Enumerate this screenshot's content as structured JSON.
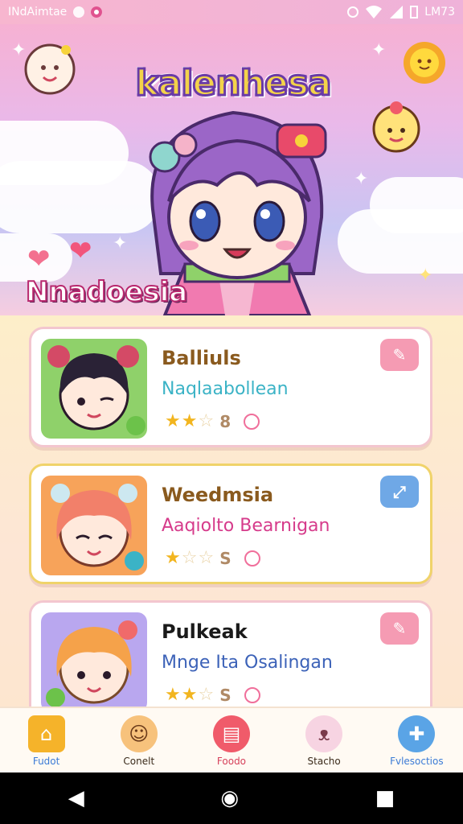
{
  "status_bar": {
    "left_text": "INdAimtae",
    "time": "LM73"
  },
  "hero": {
    "app_title": "kalenhesa",
    "subtitle": "Nnadoesia"
  },
  "cards": [
    {
      "name": "Balliuls",
      "tagline": "Naqlaabollean",
      "rating": "8",
      "stars_filled": 2,
      "stars_total": 3,
      "tag_color": "#3bb3c6",
      "action_icon": "pencil-icon",
      "action_color": "#f59bb3"
    },
    {
      "name": "Weedmsia",
      "tagline": "Aaqiolto Bearnigan",
      "rating": "S",
      "stars_filled": 1,
      "stars_total": 3,
      "tag_color": "#d63b8b",
      "action_icon": "link-icon",
      "action_color": "#6fa8e6"
    },
    {
      "name": "Pulkeak",
      "tagline": "Mnge Ita Osalingan",
      "rating": "S",
      "stars_filled": 2,
      "stars_total": 3,
      "tag_color": "#3c62b8",
      "action_icon": "pencil-icon",
      "action_color": "#f59bb3"
    }
  ],
  "bottom_nav": [
    {
      "label": "Fudot",
      "icon": "home-icon",
      "color": "#f5b32a"
    },
    {
      "label": "Conelt",
      "icon": "character-icon",
      "color": "#f7c27c"
    },
    {
      "label": "Foodo",
      "icon": "clipboard-icon",
      "color": "#f05b6a"
    },
    {
      "label": "Stacho",
      "icon": "pet-icon",
      "color": "#f7d4e2"
    },
    {
      "label": "Fvlesoctios",
      "icon": "globe-plus-icon",
      "color": "#5aa4e6"
    }
  ],
  "system_nav": {
    "back": "◀",
    "home": "◉",
    "recents": "■"
  }
}
